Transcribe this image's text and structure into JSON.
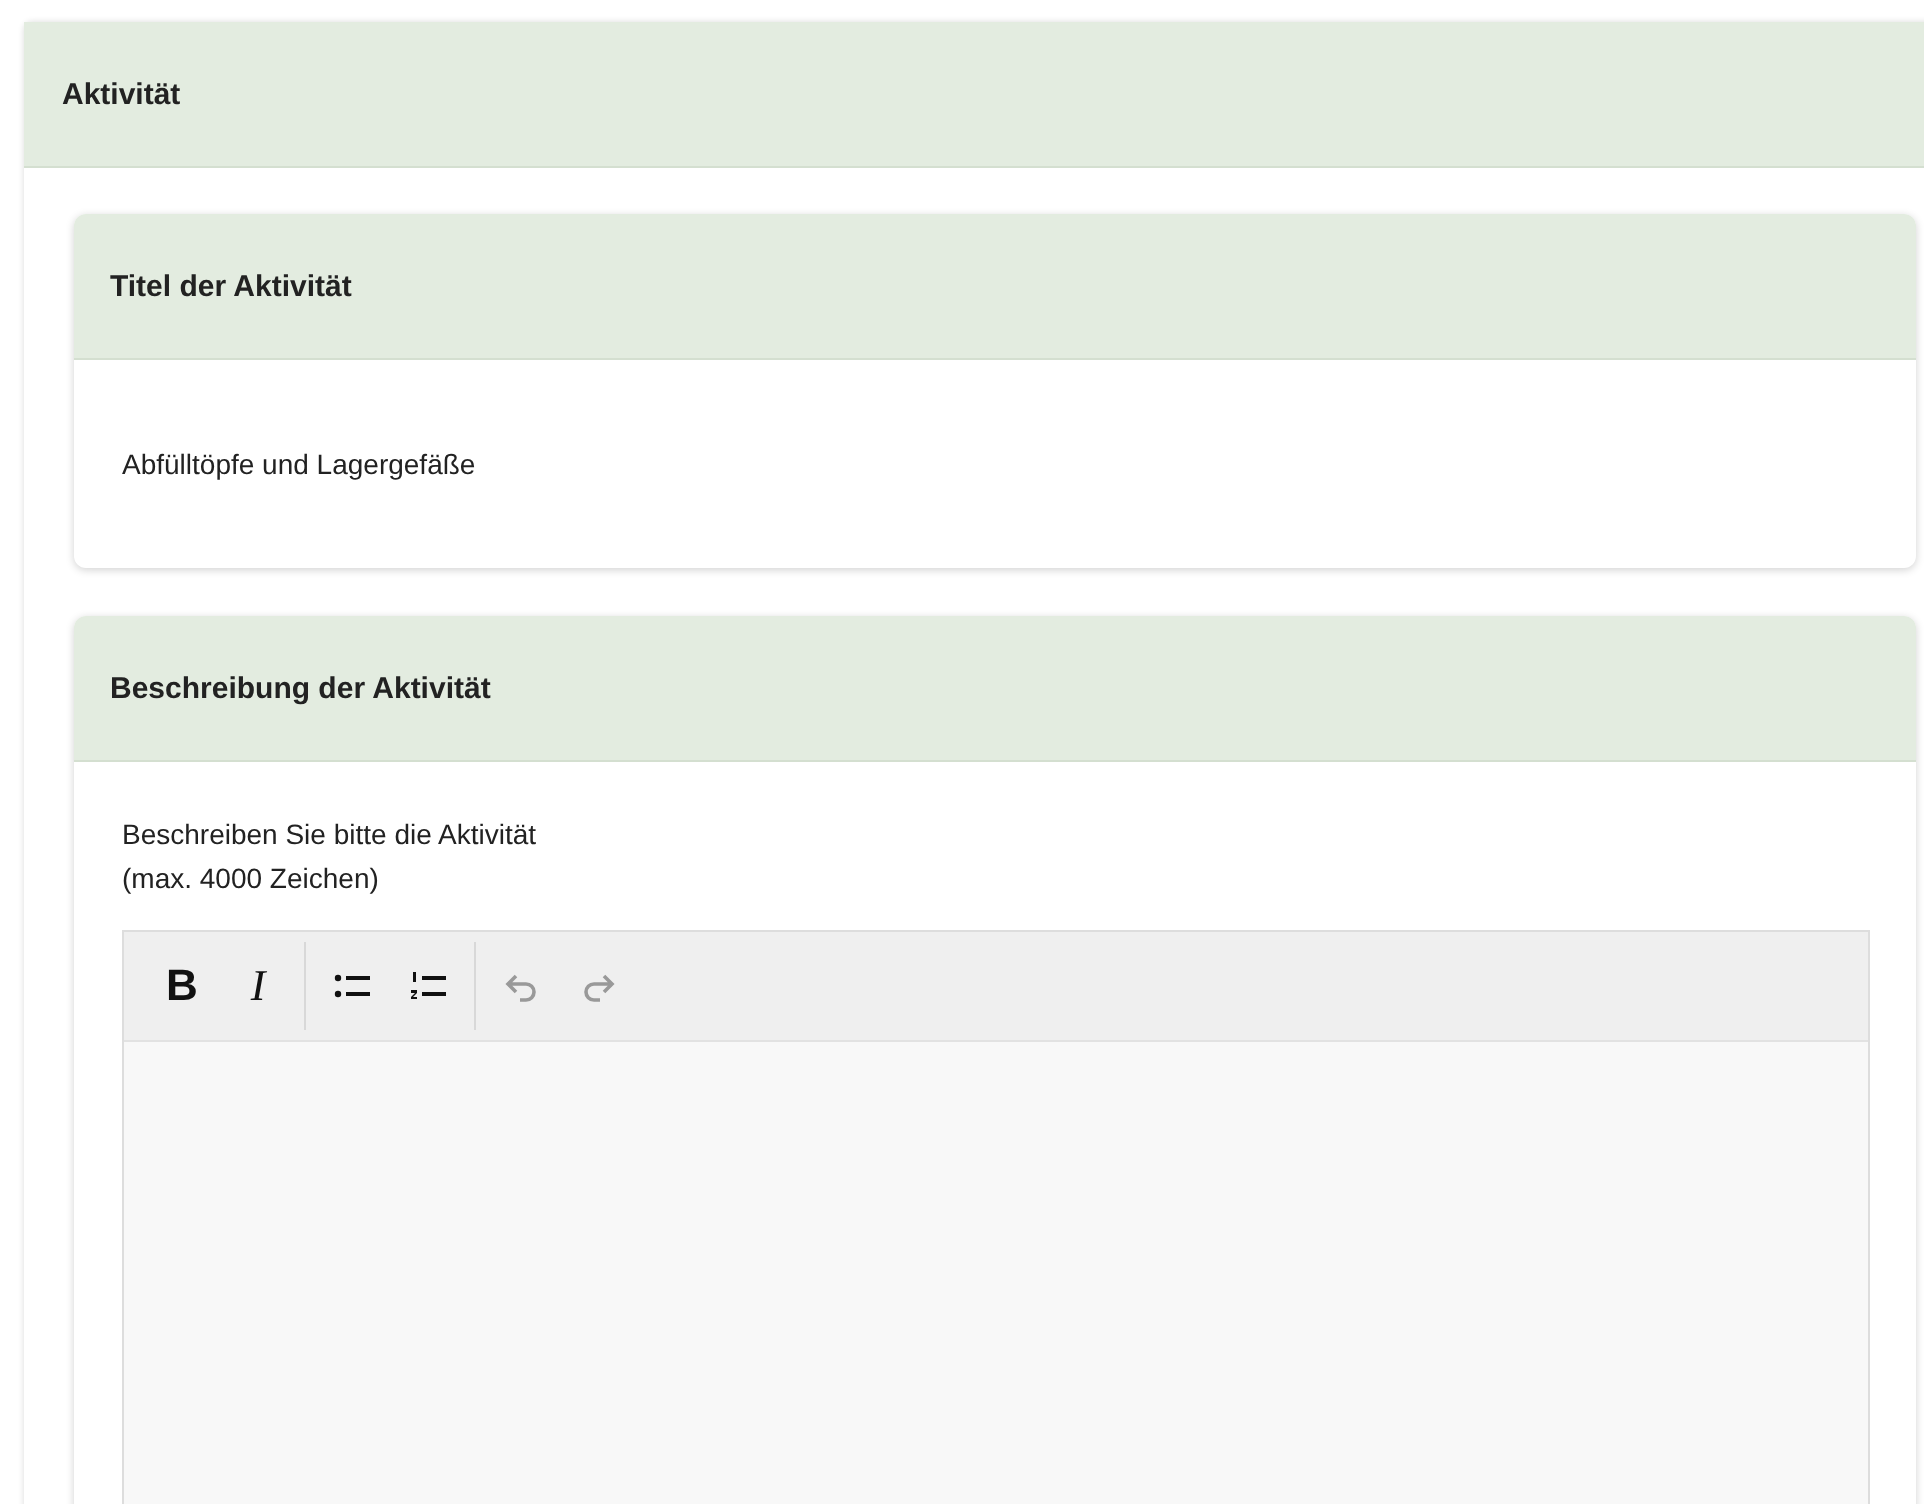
{
  "panel": {
    "title": "Aktivität"
  },
  "sections": [
    {
      "kind": "text",
      "title": "Titel der Aktivität",
      "value": "Abfülltöpfe und Lagergefäße"
    },
    {
      "kind": "editor",
      "title": "Beschreibung der Aktivität",
      "instructions": [
        "Beschreiben Sie bitte die Aktivität",
        "(max. 4000 Zeichen)"
      ],
      "toolbar": [
        [
          {
            "kind": "bold",
            "label": "B",
            "disabled": false
          },
          {
            "kind": "italic",
            "label": "I",
            "disabled": false
          }
        ],
        [
          {
            "kind": "bullet-list",
            "disabled": false
          },
          {
            "kind": "numbered-list",
            "disabled": false
          }
        ],
        [
          {
            "kind": "undo",
            "disabled": true
          },
          {
            "kind": "redo",
            "disabled": true
          }
        ]
      ]
    }
  ]
}
